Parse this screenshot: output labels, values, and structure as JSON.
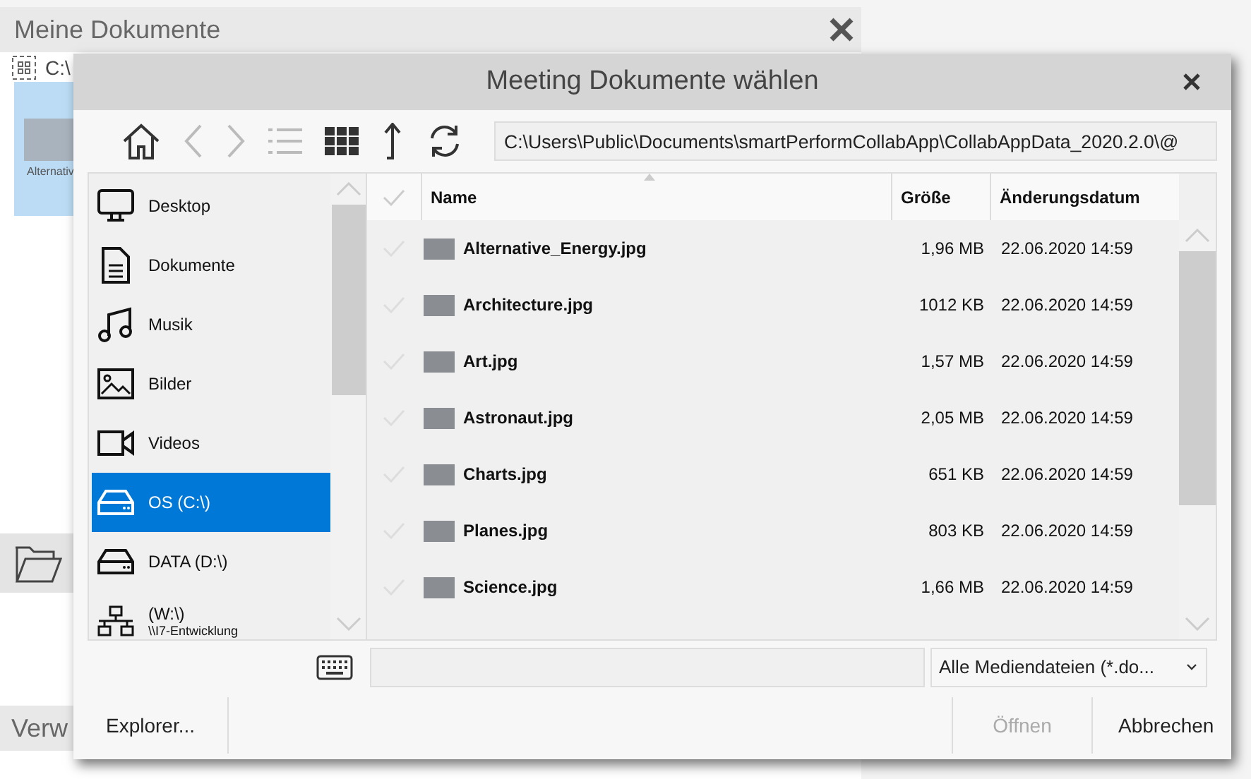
{
  "background_window": {
    "title": "Meine Dokumente",
    "path": "C:\\",
    "thumbnail_label": "Alternativ",
    "section_title": "Verw"
  },
  "dialog": {
    "title": "Meeting Dokumente wählen",
    "path": "C:\\Users\\Public\\Documents\\smartPerformCollabApp\\CollabAppData_2020.2.0\\@",
    "sidebar": {
      "items": [
        {
          "label": "Desktop",
          "kind": "desktop",
          "selected": false
        },
        {
          "label": "Dokumente",
          "kind": "document",
          "selected": false
        },
        {
          "label": "Musik",
          "kind": "music",
          "selected": false
        },
        {
          "label": "Bilder",
          "kind": "image",
          "selected": false
        },
        {
          "label": "Videos",
          "kind": "video",
          "selected": false
        },
        {
          "label": "OS (C:\\)",
          "kind": "drive",
          "selected": true
        },
        {
          "label": "DATA (D:\\)",
          "kind": "drive",
          "selected": false
        },
        {
          "label": "(W:\\)",
          "sublabel": "\\\\I7-Entwicklung",
          "kind": "network",
          "selected": false
        }
      ]
    },
    "table": {
      "columns": [
        "Name",
        "Größe",
        "Änderungsdatum"
      ],
      "rows": [
        {
          "name": "Alternative_Energy.jpg",
          "size": "1,96 MB",
          "date": "22.06.2020 14:59",
          "checked": false
        },
        {
          "name": "Architecture.jpg",
          "size": "1012 KB",
          "date": "22.06.2020 14:59",
          "checked": false
        },
        {
          "name": "Art.jpg",
          "size": "1,57 MB",
          "date": "22.06.2020 14:59",
          "checked": false
        },
        {
          "name": "Astronaut.jpg",
          "size": "2,05 MB",
          "date": "22.06.2020 14:59",
          "checked": false
        },
        {
          "name": "Charts.jpg",
          "size": "651 KB",
          "date": "22.06.2020 14:59",
          "checked": false
        },
        {
          "name": "Planes.jpg",
          "size": "803 KB",
          "date": "22.06.2020 14:59",
          "checked": false
        },
        {
          "name": "Science.jpg",
          "size": "1,66 MB",
          "date": "22.06.2020 14:59",
          "checked": false
        }
      ]
    },
    "filter": "Alle Mediendateien (*.do...",
    "buttons": [
      {
        "label": "Explorer...",
        "disabled": false
      },
      {
        "label": "Öffnen",
        "disabled": true
      },
      {
        "label": "Abbrechen",
        "disabled": false
      }
    ]
  }
}
